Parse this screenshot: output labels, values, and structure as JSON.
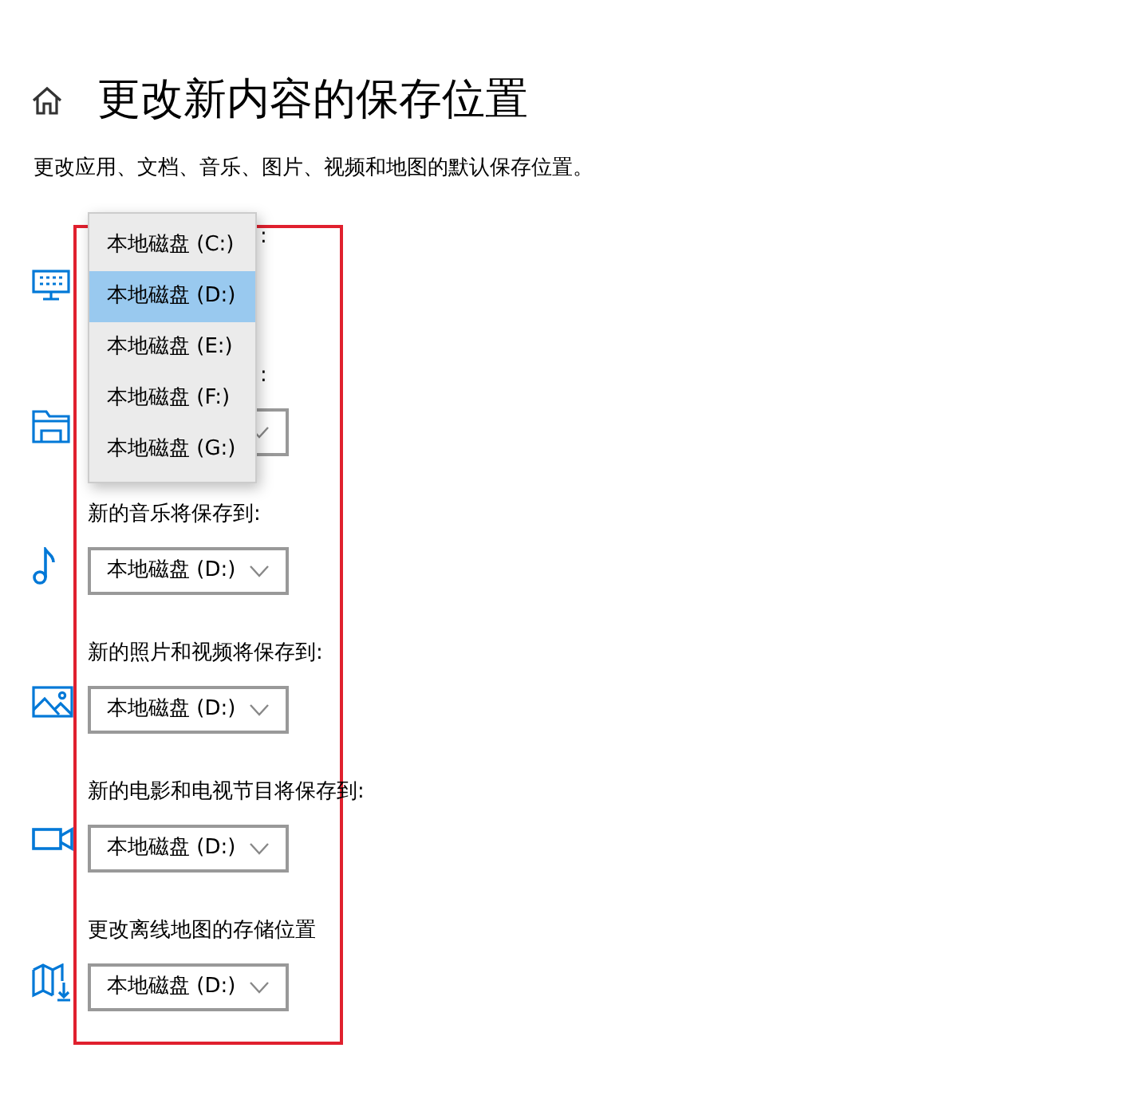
{
  "page": {
    "title": "更改新内容的保存位置",
    "description": "更改应用、文档、音乐、图片、视频和地图的默认保存位置。"
  },
  "rows": [
    {
      "kind": "covered",
      "label": ":"
    },
    {
      "kind": "partly-covered",
      "label": ":"
    },
    {
      "kind": "dropdown",
      "label": "新的音乐将保存到:",
      "value": "本地磁盘 (D:)"
    },
    {
      "kind": "dropdown",
      "label": "新的照片和视频将保存到:",
      "value": "本地磁盘 (D:)"
    },
    {
      "kind": "dropdown",
      "label": "新的电影和电视节目将保存到:",
      "value": "本地磁盘 (D:)"
    },
    {
      "kind": "dropdown",
      "label": "更改离线地图的存储位置",
      "value": "本地磁盘 (D:)"
    }
  ],
  "dropdown_menu": [
    {
      "label": "本地磁盘 (C:)",
      "selected": false
    },
    {
      "label": "本地磁盘 (D:)",
      "selected": true
    },
    {
      "label": "本地磁盘 (E:)",
      "selected": false
    },
    {
      "label": "本地磁盘 (F:)",
      "selected": false
    },
    {
      "label": "本地磁盘 (G:)",
      "selected": false
    }
  ]
}
